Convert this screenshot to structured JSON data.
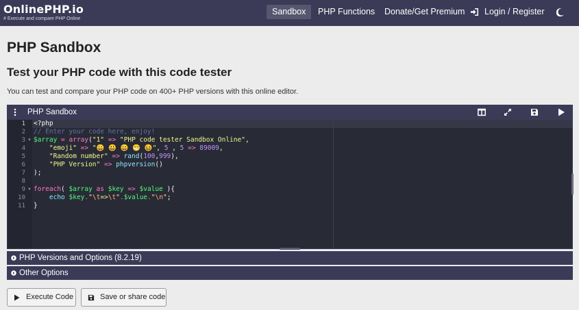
{
  "navbar": {
    "brand": "OnlinePHP.io",
    "tagline": "# Execute and compare PHP Online",
    "items": [
      {
        "label": "Sandbox",
        "active": true
      },
      {
        "label": "PHP Functions"
      },
      {
        "label": "Donate/Get Premium"
      },
      {
        "label": "Login / Register",
        "icon": "login-icon"
      }
    ],
    "theme_icon": "moon-icon"
  },
  "page": {
    "title": "PHP Sandbox",
    "subtitle": "Test your PHP code with this code tester",
    "description": "You can test and compare your PHP code on 400+ PHP versions with this online editor."
  },
  "sandbox": {
    "title": "PHP Sandbox",
    "toolbar_icons": [
      "menu-dots-icon",
      "split-layout-icon",
      "expand-icon",
      "save-icon",
      "play-icon"
    ],
    "line_numbers": [
      "1",
      "2",
      "3",
      "4",
      "5",
      "6",
      "7",
      "8",
      "9",
      "10",
      "11"
    ],
    "code": {
      "l1": "<?php",
      "l2": "// Enter your code here, enjoy!",
      "l3": {
        "var": "$array",
        "eq": " = ",
        "fn": "array",
        "open": "(",
        "key": "\"1\"",
        "arrow": " => ",
        "str": "\"PHP code tester Sandbox Online\"",
        "comma": ","
      },
      "l4": {
        "key": "\"emoji\"",
        "arrow": " => ",
        "str": "\"😀 😃 😄 😁 😆\"",
        "sep1": ", ",
        "n5": "5",
        "sep2": " , ",
        "n5b": "5",
        "arrow2": " => ",
        "n89009": "89009",
        "comma": ","
      },
      "l5": {
        "key": "\"Random number\"",
        "arrow": " => ",
        "fn": "rand",
        "open": "(",
        "a": "100",
        "c": ",",
        "b": "999",
        "close": "),"
      },
      "l6": {
        "key": "\"PHP Version\"",
        "arrow": " => ",
        "fn": "phpversion",
        "paren": "()"
      },
      "l7": ");",
      "l9": {
        "kw": "foreach",
        "open": "( ",
        "var1": "$array",
        "as": " as ",
        "var2": "$key",
        "arrow": " => ",
        "var3": "$value",
        "close": " ){"
      },
      "l10": {
        "kw": "echo",
        "sp": " ",
        "var1": "$key",
        "dot1": ".",
        "s1a": "\"",
        "esc1": "\\t",
        "s1b": "=>",
        "esc2": "\\t",
        "s1c": "\"",
        "dot2": ".",
        "var2": "$value",
        "dot3": ".",
        "s2a": "\"",
        "esc3": "\\n",
        "s2b": "\"",
        "end": ";"
      },
      "l11": "}"
    }
  },
  "sections": {
    "versions": "PHP Versions and Options (8.2.19)",
    "other": "Other Options"
  },
  "buttons": {
    "execute": "Execute Code",
    "save": "Save or share code"
  },
  "colors": {
    "navbar": "#3b3a57",
    "editor_bg": "#282a36",
    "page_bg": "#ececec"
  }
}
